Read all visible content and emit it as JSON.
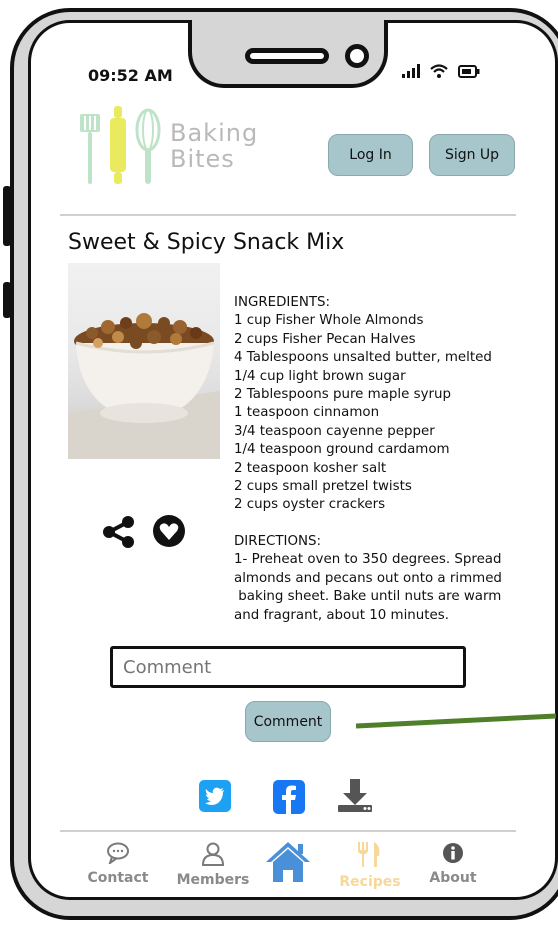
{
  "status_bar": {
    "time": "09:52 AM"
  },
  "header": {
    "logo_line1": "Baking",
    "logo_line2": "Bites",
    "login_label": "Log In",
    "signup_label": "Sign Up"
  },
  "recipe": {
    "title": "Sweet & Spicy Snack Mix",
    "ingredients_heading": "INGREDIENTS:",
    "ingredients": [
      "1 cup Fisher Whole Almonds",
      "2 cups Fisher Pecan Halves",
      "4 Tablespoons unsalted butter, melted",
      "1/4 cup light brown sugar",
      "2 Tablespoons pure maple syrup",
      "1 teaspoon cinnamon",
      "3/4 teaspoon cayenne pepper",
      "1/4 teaspoon ground cardamom",
      "2 teaspoon kosher salt",
      "2 cups small pretzel twists",
      "2 cups oyster crackers"
    ],
    "directions_heading": "DIRECTIONS:",
    "directions": [
      "1- Preheat oven to 350 degrees. Spread",
      "almonds and pecans out onto a rimmed",
      " baking sheet. Bake until nuts are warm",
      "and fragrant, about 10 minutes."
    ]
  },
  "comment": {
    "placeholder": "Comment",
    "button_label": "Comment"
  },
  "social_icons": [
    "twitter-icon",
    "facebook-icon",
    "download-icon"
  ],
  "nav": {
    "items": [
      {
        "label": "Contact",
        "icon": "chat-bubble-icon"
      },
      {
        "label": "Members",
        "icon": "person-icon"
      },
      {
        "label": "",
        "icon": "home-icon"
      },
      {
        "label": "Recipes",
        "icon": "utensils-icon"
      },
      {
        "label": "About",
        "icon": "info-icon"
      }
    ]
  },
  "colors": {
    "button_fill": "#a7c6cc",
    "twitter": "#1da1f2",
    "facebook": "#1877f2",
    "home_blue": "#4a90d9",
    "recipes_highlight": "#f7d79a",
    "arrow_green": "#4f7f2a",
    "logo_yellow": "#eaea5f",
    "logo_green": "#bfe3c8"
  }
}
